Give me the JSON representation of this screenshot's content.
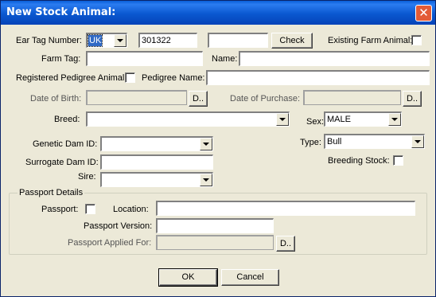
{
  "window": {
    "title": "New Stock Animal:"
  },
  "form": {
    "ear_tag_label": "Ear Tag Number:",
    "ear_tag_country": "UK",
    "ear_tag_number": "301322",
    "ear_tag_extra": "",
    "check_label": "Check",
    "existing_farm_animal_label": "Existing Farm Animal:",
    "existing_farm_animal_checked": false,
    "farm_tag_label": "Farm Tag:",
    "farm_tag_value": "",
    "name_label": "Name:",
    "name_value": "",
    "registered_pedigree_label": "Registered Pedigree Animal:",
    "pedigree_name_label": "Pedigree Name:",
    "pedigree_name_value": "",
    "dob_label": "Date of Birth:",
    "dob_value": "",
    "dob_button": "D..",
    "dop_label": "Date of Purchase:",
    "dop_value": "",
    "dop_button": "D..",
    "breed_label": "Breed:",
    "breed_value": "",
    "sex_label": "Sex:",
    "sex_value": "MALE",
    "genetic_dam_label": "Genetic Dam ID:",
    "genetic_dam_value": "",
    "type_label": "Type:",
    "type_value": "Bull",
    "surrogate_dam_label": "Surrogate Dam ID:",
    "surrogate_dam_value": "",
    "breeding_stock_label": "Breeding Stock:",
    "sire_label": "Sire:",
    "sire_value": ""
  },
  "passport": {
    "group_label": "Passport Details",
    "passport_label": "Passport:",
    "location_label": "Location:",
    "location_value": "",
    "version_label": "Passport Version:",
    "version_value": "",
    "applied_label": "Passport Applied For:",
    "applied_value": "",
    "applied_button": "D.."
  },
  "buttons": {
    "ok": "OK",
    "cancel": "Cancel"
  },
  "colors": {
    "titlebar": "#0a58d0",
    "dialog_bg": "#ece9d8",
    "selection": "#316ac5",
    "close": "#e35b36"
  }
}
